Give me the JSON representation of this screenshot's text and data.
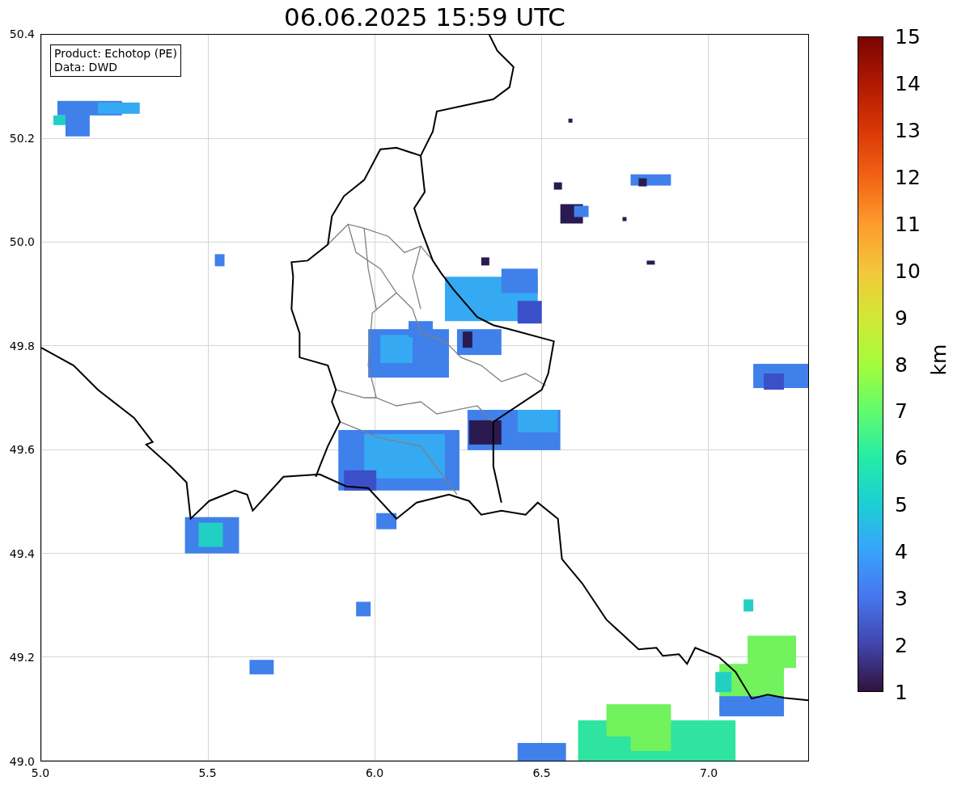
{
  "title": "06.06.2025 15:59 UTC",
  "map": {
    "legend": [
      "Product: Echotop (PE)",
      "Data: DWD"
    ],
    "y_ticks": [
      "50.4",
      "50.2",
      "50.0",
      "49.8",
      "49.6",
      "49.4",
      "49.2",
      "49.0"
    ],
    "x_ticks": [
      "5.0",
      "5.5",
      "6.0",
      "6.5",
      "7.0"
    ]
  },
  "colorbar": {
    "label": "km",
    "ticks": [
      "15",
      "14",
      "13",
      "12",
      "11",
      "10",
      "9",
      "8",
      "7",
      "6",
      "5",
      "4",
      "3",
      "2",
      "1"
    ]
  }
}
